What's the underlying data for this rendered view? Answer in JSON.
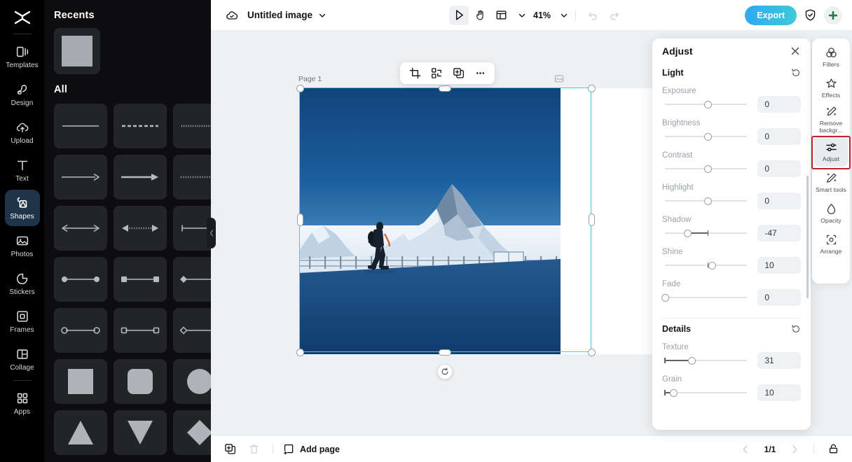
{
  "app": {
    "logo_icon": "capcut-logo-icon"
  },
  "left_rail": {
    "items": [
      {
        "label": "Templates",
        "icon": "templates-icon",
        "active": false
      },
      {
        "label": "Design",
        "icon": "design-icon",
        "active": false
      },
      {
        "label": "Upload",
        "icon": "upload-cloud-icon",
        "active": false
      },
      {
        "label": "Text",
        "icon": "text-icon",
        "active": false
      },
      {
        "label": "Shapes",
        "icon": "shapes-icon",
        "active": true
      },
      {
        "label": "Photos",
        "icon": "photos-icon",
        "active": false
      },
      {
        "label": "Stickers",
        "icon": "stickers-icon",
        "active": false
      },
      {
        "label": "Frames",
        "icon": "frames-icon",
        "active": false
      },
      {
        "label": "Collage",
        "icon": "collage-icon",
        "active": false
      },
      {
        "label": "Apps",
        "icon": "apps-grid-icon",
        "active": false
      }
    ]
  },
  "shapes_panel": {
    "recents_title": "Recents",
    "all_title": "All",
    "recent_items": [
      {
        "name": "square-shape"
      }
    ],
    "all_items": [
      {
        "name": "line-solid"
      },
      {
        "name": "line-dashed"
      },
      {
        "name": "line-dotted"
      },
      {
        "name": "arrow-solid"
      },
      {
        "name": "arrow-thick"
      },
      {
        "name": "arrow-dotted"
      },
      {
        "name": "double-arrow"
      },
      {
        "name": "dotted-double-arrow"
      },
      {
        "name": "bar-line"
      },
      {
        "name": "dot-line-dot"
      },
      {
        "name": "square-line-square"
      },
      {
        "name": "diamond-line-diamond"
      },
      {
        "name": "circle-outline-line"
      },
      {
        "name": "square-outline-line"
      },
      {
        "name": "diamond-outline-line"
      },
      {
        "name": "square-fill"
      },
      {
        "name": "rounded-square-fill"
      },
      {
        "name": "circle-fill"
      },
      {
        "name": "triangle-up"
      },
      {
        "name": "triangle-down"
      },
      {
        "name": "diamond-fill"
      }
    ]
  },
  "topbar": {
    "cloud_icon": "cloud-saved-icon",
    "doc_title": "Untitled image",
    "title_caret_icon": "chevron-down-icon",
    "tools": [
      {
        "name": "select-tool",
        "icon": "cursor-icon",
        "selected": true
      },
      {
        "name": "hand-tool",
        "icon": "hand-icon",
        "selected": false
      },
      {
        "name": "layout-tool",
        "icon": "layout-icon",
        "selected": false
      }
    ],
    "layout_caret_icon": "chevron-down-icon",
    "zoom_level": "41%",
    "zoom_caret_icon": "chevron-down-icon",
    "undo_icon": "undo-icon",
    "redo_icon": "redo-icon",
    "export_label": "Export",
    "shield_icon": "shield-check-icon",
    "avatar_icon": "avatar-plus-icon"
  },
  "canvas": {
    "page_label": "Page 1",
    "selection_color": "#3fd0e0",
    "background": "#eef1f4",
    "float_toolbar": [
      {
        "name": "crop-button",
        "icon": "crop-icon"
      },
      {
        "name": "replace-button",
        "icon": "replace-icon"
      },
      {
        "name": "duplicate-button",
        "icon": "duplicate-icon"
      },
      {
        "name": "more-button",
        "icon": "ellipsis-icon"
      }
    ],
    "corner_badge_icon": "image-badge-icon",
    "rotate_icon": "rotate-icon"
  },
  "bottombar": {
    "duplicate_page_icon": "duplicate-page-icon",
    "delete_page_icon": "trash-icon",
    "add_page_label": "Add page",
    "add_page_icon": "add-page-icon",
    "prev_icon": "chevron-left-icon",
    "page_indicator": "1/1",
    "next_icon": "chevron-right-icon",
    "unlock_icon": "lock-icon"
  },
  "adjust_panel": {
    "title": "Adjust",
    "close_icon": "close-icon",
    "sections": [
      {
        "title": "Light",
        "reset_icon": "reset-icon",
        "controls": [
          {
            "label": "Exposure",
            "value": "0",
            "pos": 50,
            "origin": 50
          },
          {
            "label": "Brightness",
            "value": "0",
            "pos": 50,
            "origin": 50
          },
          {
            "label": "Contrast",
            "value": "0",
            "pos": 50,
            "origin": 50
          },
          {
            "label": "Highlight",
            "value": "0",
            "pos": 50,
            "origin": 50
          },
          {
            "label": "Shadow",
            "value": "-47",
            "pos": 26.5,
            "origin": 50
          },
          {
            "label": "Shine",
            "value": "10",
            "pos": 55,
            "origin": 50
          },
          {
            "label": "Fade",
            "value": "0",
            "pos": 0,
            "origin": 0
          }
        ]
      },
      {
        "title": "Details",
        "reset_icon": "reset-icon",
        "controls": [
          {
            "label": "Texture",
            "value": "31",
            "pos": 31,
            "origin": 0
          },
          {
            "label": "Grain",
            "value": "10",
            "pos": 10,
            "origin": 0
          }
        ]
      }
    ]
  },
  "right_rail": {
    "items": [
      {
        "label": "Filters",
        "icon": "filters-icon",
        "active": false,
        "highlight": false
      },
      {
        "label": "Effects",
        "icon": "effects-icon",
        "active": false,
        "highlight": false
      },
      {
        "label": "Remove backgr...",
        "icon": "remove-background-icon",
        "active": false,
        "highlight": false
      },
      {
        "label": "Adjust",
        "icon": "adjust-sliders-icon",
        "active": true,
        "highlight": true
      },
      {
        "label": "Smart tools",
        "icon": "smart-tools-icon",
        "active": false,
        "highlight": false
      },
      {
        "label": "Opacity",
        "icon": "opacity-icon",
        "active": false,
        "highlight": false
      },
      {
        "label": "Arrange",
        "icon": "arrange-icon",
        "active": false,
        "highlight": false
      }
    ],
    "highlight_color": "#c0232b"
  }
}
